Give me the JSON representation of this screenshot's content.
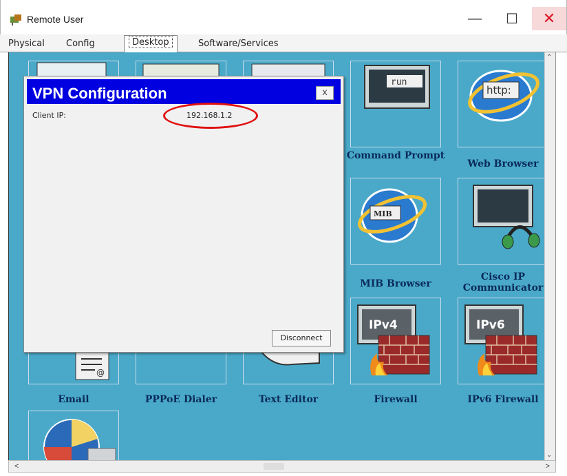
{
  "window": {
    "title": "Remote User"
  },
  "tabs": [
    {
      "label": "Physical"
    },
    {
      "label": "Config"
    },
    {
      "label": "Desktop"
    },
    {
      "label": "Software/Services"
    }
  ],
  "desktop_apps": [
    {
      "label": "Command Prompt",
      "icon": "command-prompt-icon",
      "badge": "run"
    },
    {
      "label": "Web Browser",
      "icon": "web-browser-icon",
      "badge": "http:"
    },
    {
      "label": "MIB Browser",
      "icon": "mib-browser-icon",
      "badge": "MIB"
    },
    {
      "label": "Cisco IP Communicator",
      "icon": "cisco-ip-communicator-icon"
    },
    {
      "label": "Firewall",
      "icon": "firewall-icon",
      "badge": "IPv4"
    },
    {
      "label": "IPv6 Firewall",
      "icon": "ipv6-firewall-icon",
      "badge": "IPv6"
    },
    {
      "label": "Email",
      "icon": "email-icon"
    },
    {
      "label": "PPPoE Dialer",
      "icon": "pppoe-dialer-icon"
    },
    {
      "label": "Text Editor",
      "icon": "text-editor-icon"
    }
  ],
  "vpn_dialog": {
    "title": "VPN Configuration",
    "close_label": "X",
    "client_ip_label": "Client IP:",
    "client_ip_value": "192.168.1.2",
    "disconnect_label": "Disconnect"
  },
  "colors": {
    "desktop_bg": "#4aa9c8",
    "dialog_title_bg": "#0000e0",
    "highlight": "#e01010"
  }
}
